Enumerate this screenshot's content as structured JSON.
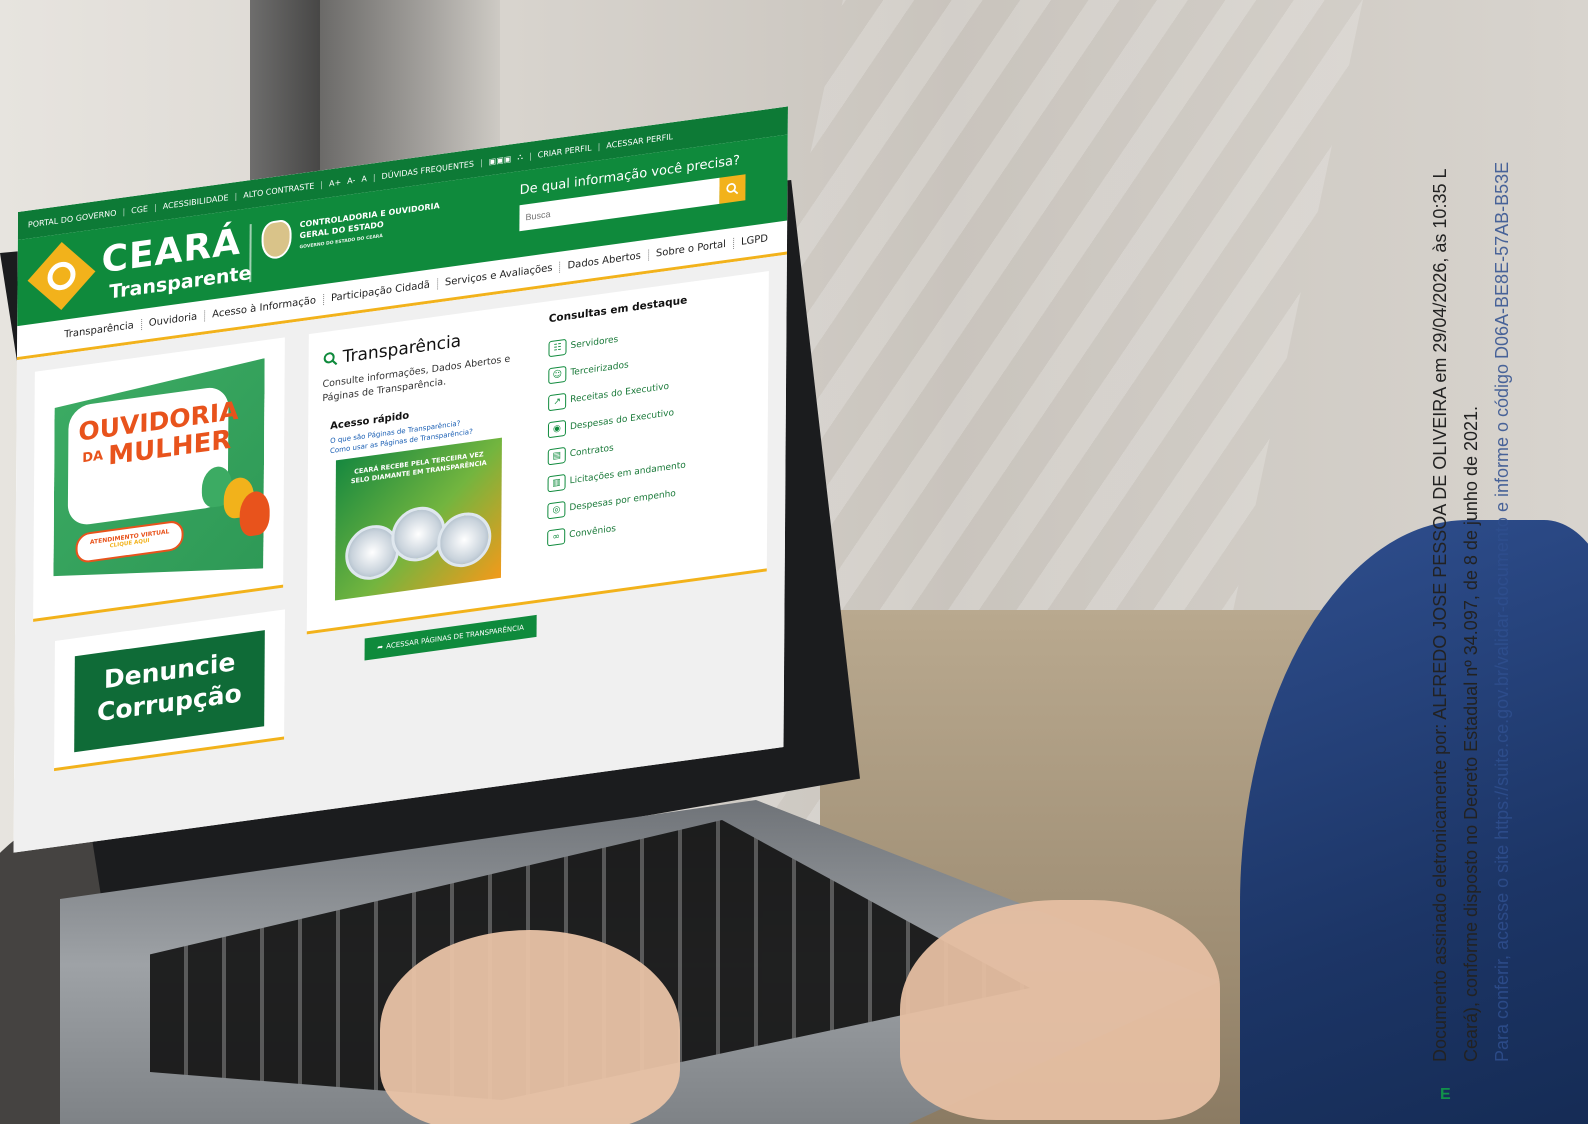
{
  "site": {
    "topbar": {
      "items": [
        "PORTAL DO GOVERNO",
        "CGE",
        "ACESSIBILIDADE",
        "ALTO CONTRASTE",
        "A+",
        "A-",
        "A",
        "DÚVIDAS FREQUENTES"
      ],
      "create_profile": "CRIAR PERFIL",
      "access_profile": "ACESSAR PERFIL"
    },
    "brand": {
      "main": "CEARÁ",
      "sub": "Transparente"
    },
    "cge": {
      "name": "CONTROLADORIA E OUVIDORIA GERAL DO ESTADO",
      "gov": "GOVERNO DO ESTADO DO CEARÁ"
    },
    "search": {
      "question": "De qual informação você precisa?",
      "placeholder": "Busca"
    },
    "nav": [
      "Transparência",
      "Ouvidoria",
      "Acesso à Informação",
      "Participação Cidadã",
      "Serviços e Avaliações",
      "Dados Abertos",
      "Sobre o Portal",
      "LGPD"
    ],
    "ouvidoria": {
      "title": "OUVIDORIA",
      "da": "DA",
      "mulher": "MULHER",
      "cta_line1": "ATENDIMENTO VIRTUAL",
      "cta_line2": "CLIQUE AQUI"
    },
    "denuncie": {
      "line1": "Denuncie",
      "line2": "Corrupção"
    },
    "transparencia": {
      "title": "Transparência",
      "description": "Consulte informações, Dados Abertos e Páginas de Transparência.",
      "quick_access": "Acesso rápido",
      "link1": "O que são Páginas de Transparência?",
      "link2": "Como usar as Páginas de Transparência?",
      "banner_text": "CEARÁ RECEBE PELA TERCEIRA VEZ SELO DIAMANTE EM TRANSPARÊNCIA",
      "button_label": "ACESSAR PÁGINAS DE TRANSPARÊNCIA"
    },
    "featured": {
      "title": "Consultas em destaque",
      "items": [
        "Servidores",
        "Terceirizados",
        "Receitas do Executivo",
        "Despesas do Executivo",
        "Contratos",
        "Licitações em andamento",
        "Despesas por empenho",
        "Convênios"
      ]
    },
    "colors": {
      "green": "#0f8a3c",
      "dark_green": "#0d7a36",
      "yellow": "#f2b21b",
      "orange": "#e8531c"
    }
  },
  "stamp": {
    "line1": "Documento assinado eletronicamente por:  ALFREDO JOSE PESSOA DE OLIVEIRA em 29/04/2026, às 10:35 L",
    "line2": "Ceará), conforme disposto no Decreto Estadual nº 34.097, de 8 de junho de 2021.",
    "line3": "Para conferir, acesse o site https://suite.ce.gov.br/validar-documento e informe o código  D06A-BE8E-57AB-B53E",
    "logo_letter": "E"
  }
}
